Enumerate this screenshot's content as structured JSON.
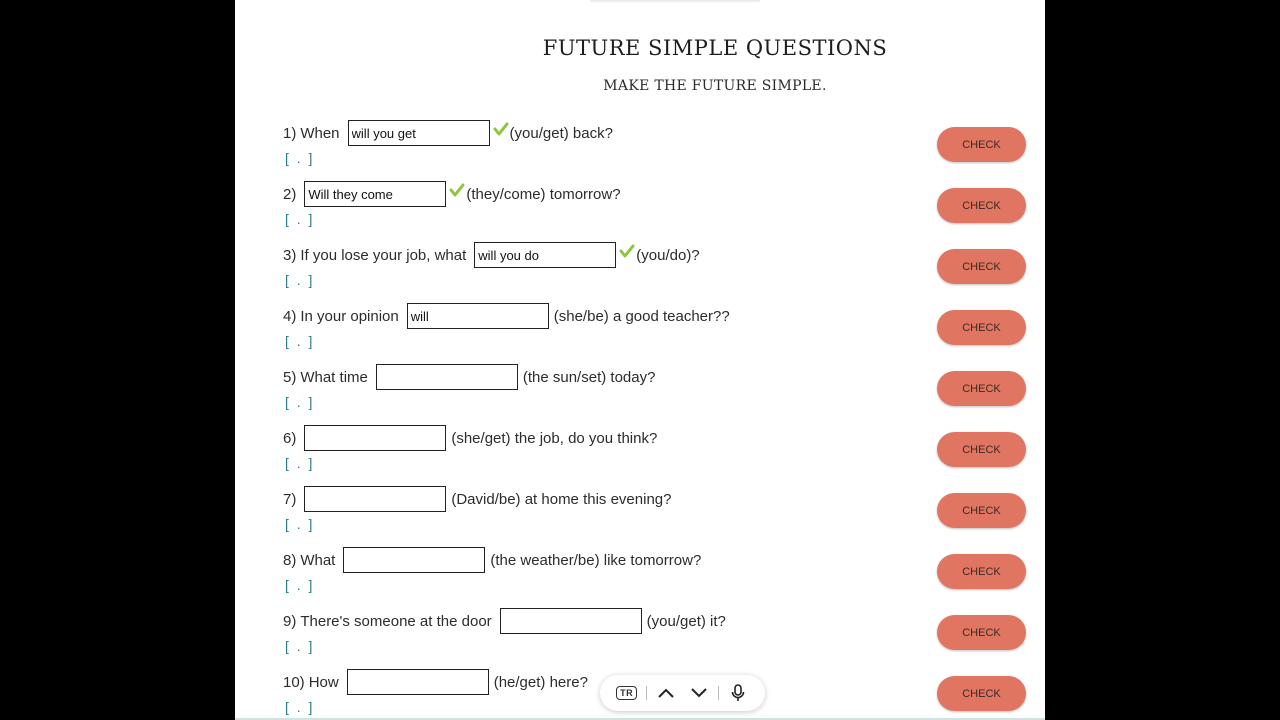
{
  "worksheet": {
    "title": "FUTURE SIMPLE QUESTIONS",
    "subtitle": "MAKE THE FUTURE SIMPLE.",
    "check_label": "CHECK",
    "feedback_placeholder": "[ . ]",
    "questions": [
      {
        "number": "1)",
        "before": "When",
        "answer": "will you get",
        "correct": true,
        "after": "(you/get) back?"
      },
      {
        "number": "2)",
        "before": "",
        "answer": "Will they come",
        "correct": true,
        "after": "(they/come) tomorrow?"
      },
      {
        "number": "3)",
        "before": "If you lose your job, what",
        "answer": "will you do",
        "correct": true,
        "after": "(you/do)?"
      },
      {
        "number": "4)",
        "before": "In your opinion",
        "answer": "will",
        "correct": false,
        "after": "(she/be) a good teacher??"
      },
      {
        "number": "5)",
        "before": "What time",
        "answer": "",
        "correct": false,
        "after": "(the sun/set) today?"
      },
      {
        "number": "6)",
        "before": "",
        "answer": "",
        "correct": false,
        "after": "(she/get) the job, do you think?"
      },
      {
        "number": "7)",
        "before": "",
        "answer": "",
        "correct": false,
        "after": "(David/be) at home this evening?"
      },
      {
        "number": "8)",
        "before": "What",
        "answer": "",
        "correct": false,
        "after": "(the weather/be) like tomorrow?"
      },
      {
        "number": "9)",
        "before": "There's someone at the door",
        "answer": "",
        "correct": false,
        "after": "(you/get) it?"
      },
      {
        "number": "10)",
        "before": "How",
        "answer": "",
        "correct": false,
        "after": "(he/get) here?"
      }
    ]
  },
  "toolbar": {
    "translate_label": "TR",
    "icons": [
      "translate-icon",
      "chevron-up-icon",
      "chevron-down-icon",
      "microphone-icon"
    ]
  },
  "colors": {
    "check_button": "#e07661",
    "checkmark": "#8cc63f",
    "feedback": "#2f7d84",
    "background": "#000000",
    "page": "#ffffff"
  }
}
